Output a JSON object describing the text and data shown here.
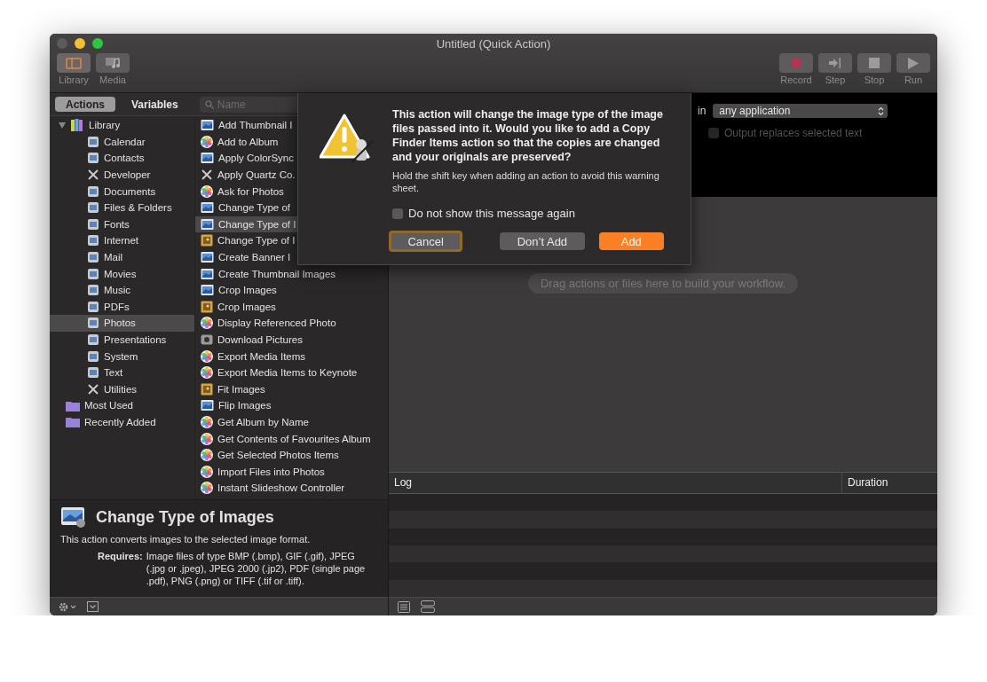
{
  "window": {
    "title": "Untitled (Quick Action)"
  },
  "toolbar": {
    "left": [
      {
        "label": "Library",
        "kind": "library",
        "on": true
      },
      {
        "label": "Media",
        "kind": "media",
        "on": false
      }
    ],
    "right": [
      {
        "label": "Record",
        "kind": "record"
      },
      {
        "label": "Step",
        "kind": "step"
      },
      {
        "label": "Stop",
        "kind": "stop"
      },
      {
        "label": "Run",
        "kind": "run"
      }
    ]
  },
  "tabs": [
    {
      "label": "Actions",
      "selected": true
    },
    {
      "label": "Variables",
      "selected": false
    }
  ],
  "search": {
    "placeholder": "Name"
  },
  "categories": [
    {
      "label": "Library",
      "kind": "library",
      "expanded": true,
      "selected": false,
      "children": [
        {
          "label": "Calendar",
          "kind": "app",
          "selected": false
        },
        {
          "label": "Contacts",
          "kind": "app",
          "selected": false
        },
        {
          "label": "Developer",
          "kind": "tool",
          "selected": false
        },
        {
          "label": "Documents",
          "kind": "app",
          "selected": false
        },
        {
          "label": "Files & Folders",
          "kind": "app",
          "selected": false
        },
        {
          "label": "Fonts",
          "kind": "app",
          "selected": false
        },
        {
          "label": "Internet",
          "kind": "app",
          "selected": false
        },
        {
          "label": "Mail",
          "kind": "app",
          "selected": false
        },
        {
          "label": "Movies",
          "kind": "app",
          "selected": false
        },
        {
          "label": "Music",
          "kind": "app",
          "selected": false
        },
        {
          "label": "PDFs",
          "kind": "app",
          "selected": false
        },
        {
          "label": "Photos",
          "kind": "app",
          "selected": true
        },
        {
          "label": "Presentations",
          "kind": "app",
          "selected": false
        },
        {
          "label": "System",
          "kind": "app",
          "selected": false
        },
        {
          "label": "Text",
          "kind": "app",
          "selected": false
        },
        {
          "label": "Utilities",
          "kind": "tool",
          "selected": false
        }
      ]
    },
    {
      "label": "Most Used",
      "kind": "folder",
      "selected": false
    },
    {
      "label": "Recently Added",
      "kind": "folder",
      "selected": false
    }
  ],
  "actions": [
    {
      "label": "Add Thumbnail I",
      "kind": "image",
      "selected": false
    },
    {
      "label": "Add to Album",
      "kind": "photos",
      "selected": false
    },
    {
      "label": "Apply ColorSync",
      "kind": "image",
      "selected": false
    },
    {
      "label": "Apply Quartz Co.",
      "kind": "tool",
      "selected": false
    },
    {
      "label": "Ask for Photos",
      "kind": "photos",
      "selected": false
    },
    {
      "label": "Change Type of",
      "kind": "image",
      "selected": false
    },
    {
      "label": "Change Type of I",
      "kind": "image",
      "selected": true
    },
    {
      "label": "Change Type of I",
      "kind": "frame",
      "selected": false
    },
    {
      "label": "Create Banner I",
      "kind": "image",
      "selected": false
    },
    {
      "label": "Create Thumbnail Images",
      "kind": "image",
      "selected": false
    },
    {
      "label": "Crop Images",
      "kind": "image",
      "selected": false
    },
    {
      "label": "Crop Images",
      "kind": "frame",
      "selected": false
    },
    {
      "label": "Display Referenced Photo",
      "kind": "photos",
      "selected": false
    },
    {
      "label": "Download Pictures",
      "kind": "download",
      "selected": false
    },
    {
      "label": "Export Media Items",
      "kind": "photos",
      "selected": false
    },
    {
      "label": "Export Media Items to Keynote",
      "kind": "photos",
      "selected": false
    },
    {
      "label": "Fit Images",
      "kind": "frame",
      "selected": false
    },
    {
      "label": "Flip Images",
      "kind": "image",
      "selected": false
    },
    {
      "label": "Get Album by Name",
      "kind": "photos",
      "selected": false
    },
    {
      "label": "Get Contents of Favourites Album",
      "kind": "photos",
      "selected": false
    },
    {
      "label": "Get Selected Photos Items",
      "kind": "photos",
      "selected": false
    },
    {
      "label": "Import Files into Photos",
      "kind": "photos",
      "selected": false
    },
    {
      "label": "Instant Slideshow Controller",
      "kind": "photos",
      "selected": false
    }
  ],
  "description": {
    "title": "Change Type of Images",
    "text": "This action converts images to the selected image format.",
    "requires_label": "Requires:",
    "requires": "Image files of type BMP (.bmp), GIF (.gif), JPEG (.jpg or .jpeg), JPEG 2000 (.jp2), PDF (single page .pdf), PNG (.png) or TIFF (.tif or .tiff)."
  },
  "input_options": {
    "in_label": "in",
    "application": "any application",
    "output_replaces": {
      "label": "Output replaces selected text",
      "checked": false,
      "disabled": true
    }
  },
  "workflow": {
    "placeholder": "Drag actions or files here to build your workflow."
  },
  "log": {
    "columns": [
      "Log",
      "Duration"
    ]
  },
  "dialog": {
    "heading": "This action will change the image type of the image files passed into it. Would you like to add a Copy Finder Items action so that the copies are changed and your originals are preserved?",
    "body": "Hold the shift key when adding an action to avoid this warning sheet.",
    "checkbox": {
      "label": "Do not show this message again",
      "checked": false
    },
    "buttons": [
      {
        "label": "Cancel",
        "kind": "focused"
      },
      {
        "label": "Don’t Add",
        "kind": "plain"
      },
      {
        "label": "Add",
        "kind": "default"
      }
    ]
  }
}
